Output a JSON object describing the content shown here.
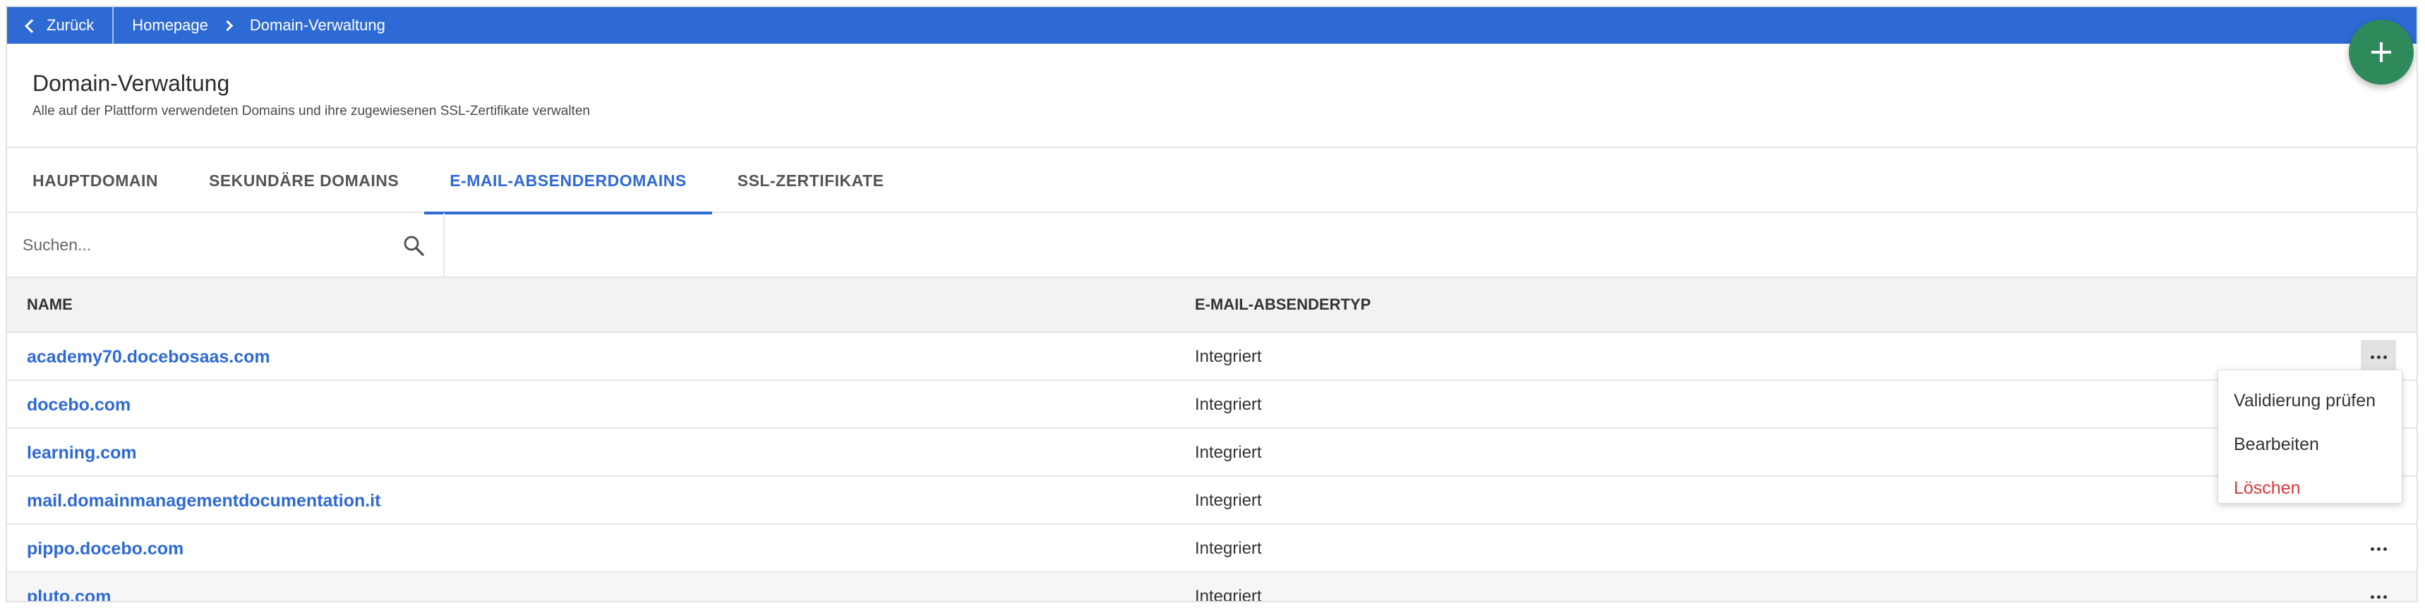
{
  "nav": {
    "back_label": "Zurück",
    "breadcrumb": [
      "Homepage",
      "Domain-Verwaltung"
    ]
  },
  "header": {
    "title": "Domain-Verwaltung",
    "subtitle": "Alle auf der Plattform verwendeten Domains und ihre zugewiesenen SSL-Zertifikate verwalten"
  },
  "fab": {
    "icon": "plus-icon",
    "color": "#2f8a5b"
  },
  "tabs": [
    {
      "label": "HAUPTDOMAIN",
      "active": false
    },
    {
      "label": "SEKUNDÄRE DOMAINS",
      "active": false
    },
    {
      "label": "E-MAIL-ABSENDERDOMAINS",
      "active": true
    },
    {
      "label": "SSL-ZERTIFIKATE",
      "active": false
    }
  ],
  "search": {
    "placeholder": "Suchen...",
    "value": ""
  },
  "table": {
    "columns": [
      "NAME",
      "E-MAIL-ABSENDERTYP"
    ],
    "rows": [
      {
        "name": "academy70.docebosaas.com",
        "type": "Integriert"
      },
      {
        "name": "docebo.com",
        "type": "Integriert"
      },
      {
        "name": "learning.com",
        "type": "Integriert"
      },
      {
        "name": "mail.domainmanagementdocumentation.it",
        "type": "Integriert"
      },
      {
        "name": "pippo.docebo.com",
        "type": "Integriert"
      },
      {
        "name": "pluto.com",
        "type": "Integriert"
      }
    ]
  },
  "row_menu": {
    "items": [
      "Validierung prüfen",
      "Bearbeiten",
      "Löschen"
    ]
  },
  "colors": {
    "primary": "#2e6ad4",
    "danger": "#d9383a",
    "fab": "#2f8a5b"
  }
}
